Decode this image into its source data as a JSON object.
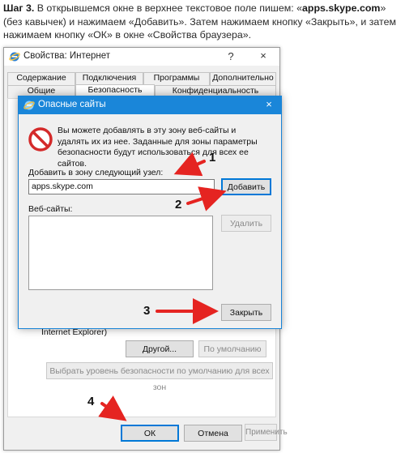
{
  "instruction": {
    "step": "Шаг 3.",
    "text_before": " В открывшемся окне в верхнее текстовое поле пишем: «",
    "site_bold": "apps.skype.com",
    "text_after": "» (без кавычек) и нажимаем «Добавить». Затем нажимаем кнопку «Закрыть», и затем нажимаем кнопку «ОК» в окне «Свойства браузера»."
  },
  "outer_window": {
    "title": "Свойства: Интернет",
    "help": "?",
    "close": "×",
    "tabs_row1": [
      "Содержание",
      "Подключения",
      "Программы",
      "Дополнительно"
    ],
    "tabs_row2": [
      "Общие",
      "Безопасность",
      "Конфиденциальность"
    ],
    "partial_text": "Internet Explorer)",
    "btn_custom": "Другой...",
    "btn_default": "По умолчанию",
    "btn_reset_all": "Выбрать уровень безопасности по умолчанию для всех зон",
    "btn_ok": "ОК",
    "btn_cancel": "Отмена",
    "btn_apply": "Применить"
  },
  "inner_dialog": {
    "title": "Опасные сайты",
    "close": "×",
    "info_text": "Вы можете добавлять в эту зону веб-сайты и удалять их из нее. Заданные для зоны параметры безопасности будут использоваться для всех ее сайтов.",
    "add_label": "Добавить в зону следующий узел:",
    "input_value": "apps.skype.com",
    "btn_add": "Добавить",
    "sites_label": "Веб-сайты:",
    "btn_remove": "Удалить",
    "btn_close": "Закрыть"
  },
  "callouts": {
    "one": "1",
    "two": "2",
    "three": "3",
    "four": "4"
  },
  "colors": {
    "arrow": "#e52421",
    "accent": "#1a86d9",
    "restricted_icon": "#d42a2a"
  },
  "icons": [
    "ie-globe-icon",
    "restricted-sites-icon",
    "arrow-icon"
  ]
}
